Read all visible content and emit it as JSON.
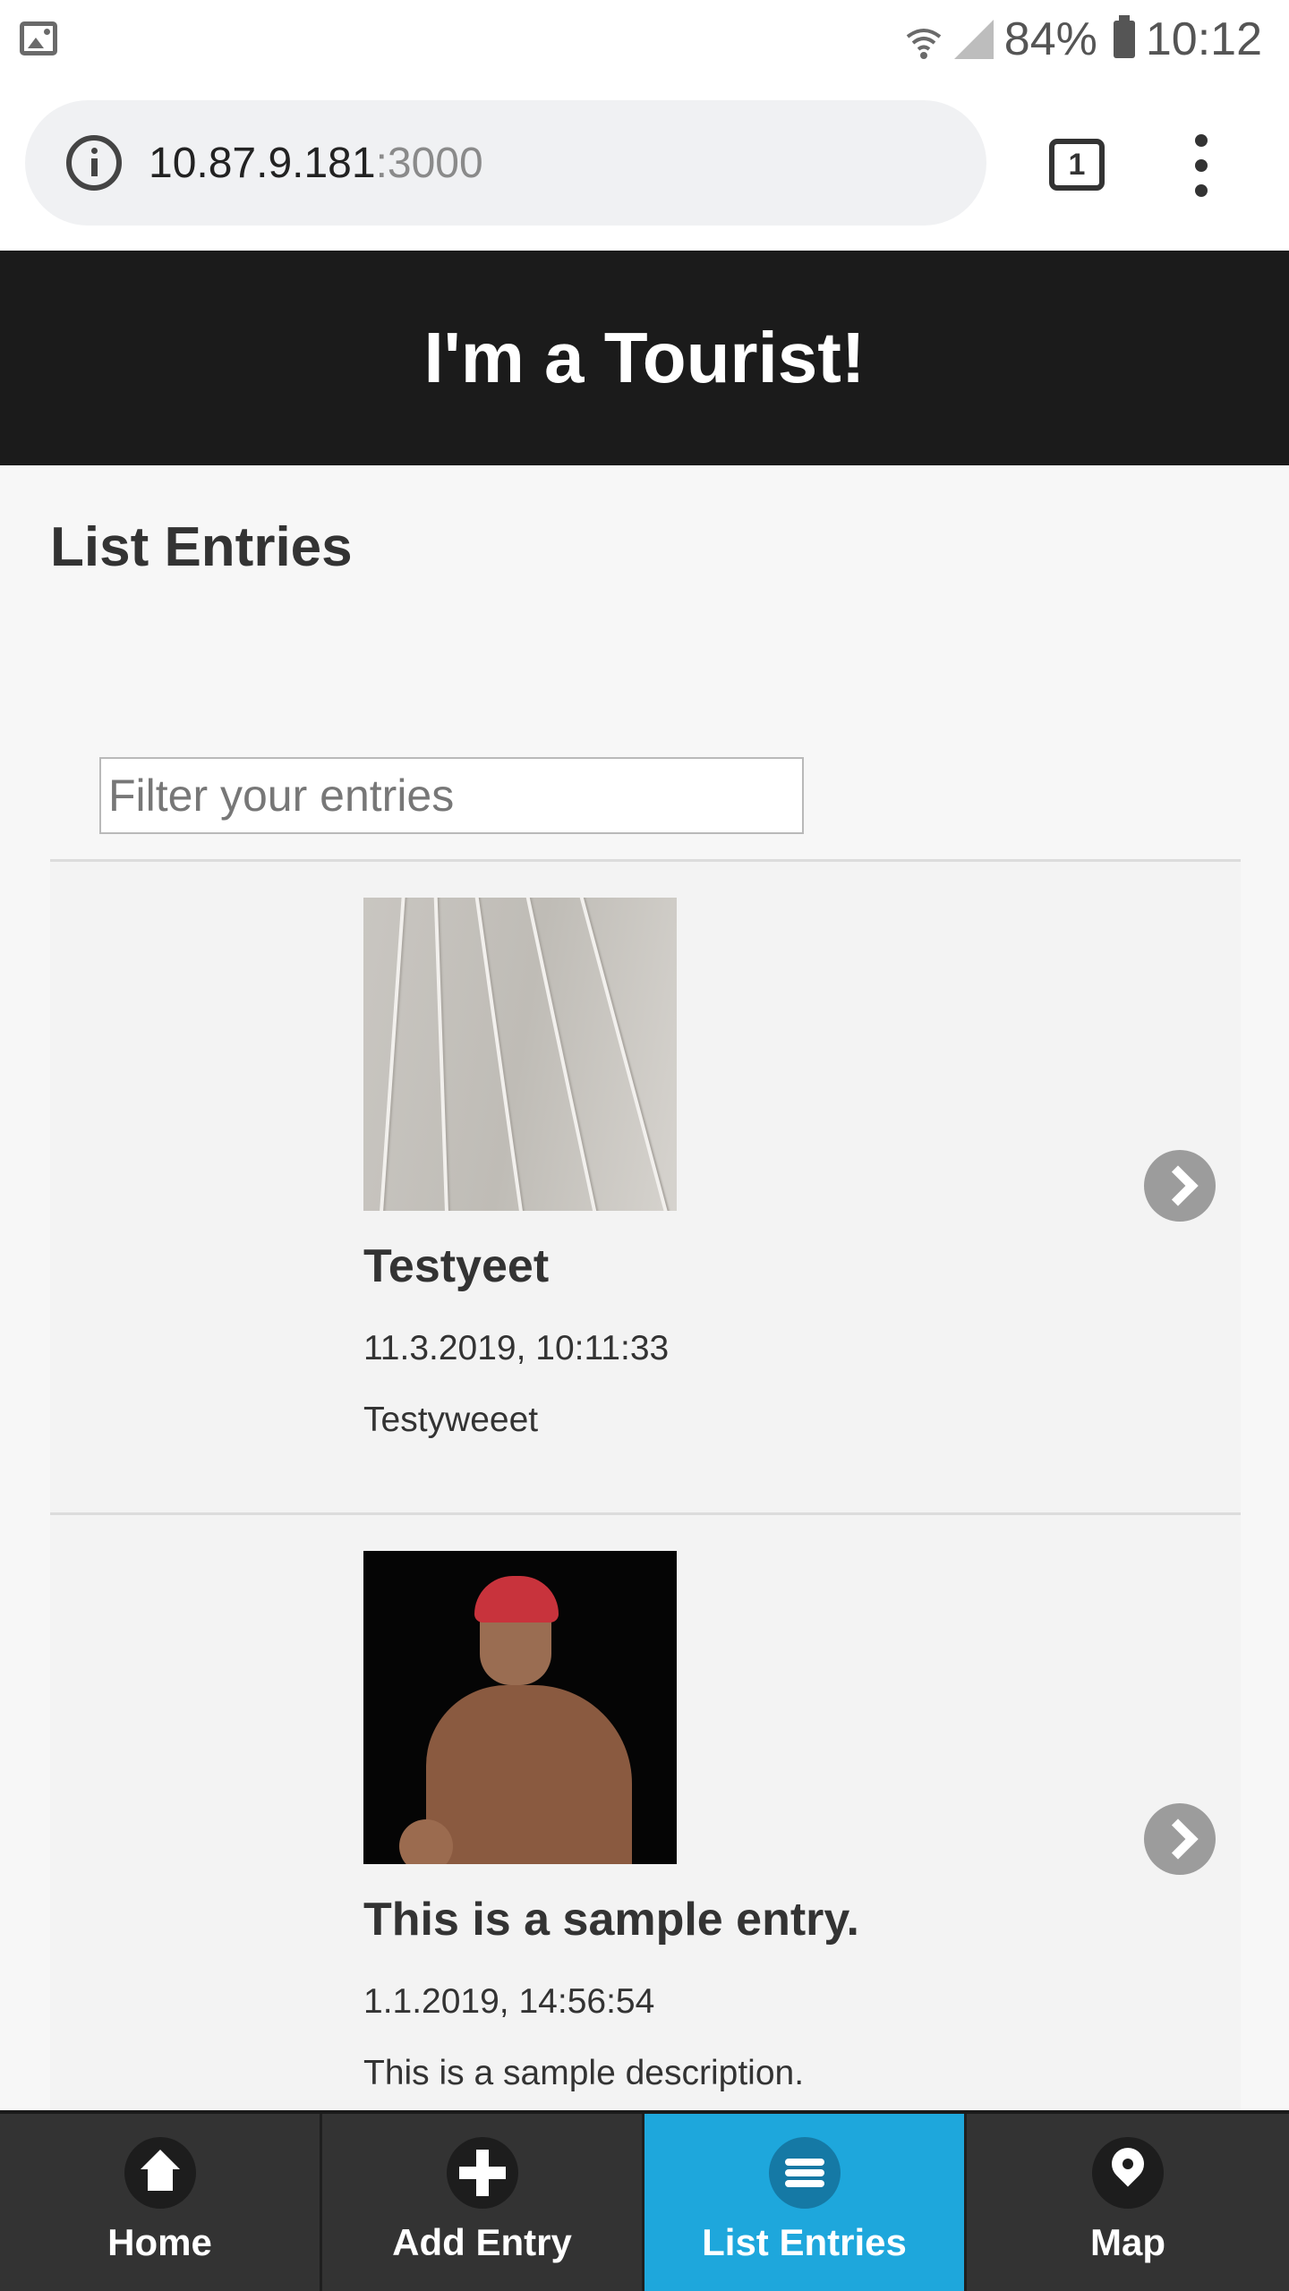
{
  "status_bar": {
    "battery": "84%",
    "time": "10:12"
  },
  "browser": {
    "url_host": "10.87.9.181",
    "url_port": ":3000",
    "tab_count": "1"
  },
  "app": {
    "title": "I'm a Tourist!"
  },
  "page": {
    "title": "List Entries",
    "filter_placeholder": "Filter your entries"
  },
  "entries": [
    {
      "title": "Testyeet",
      "date": "11.3.2019, 10:11:33",
      "description": "Testyweeet"
    },
    {
      "title": "This is a sample entry.",
      "date": "1.1.2019, 14:56:54",
      "description": "This is a sample description."
    }
  ],
  "nav": {
    "items": [
      {
        "label": "Home",
        "icon": "home-icon"
      },
      {
        "label": "Add Entry",
        "icon": "plus-icon"
      },
      {
        "label": "List Entries",
        "icon": "bars-icon"
      },
      {
        "label": "Map",
        "icon": "map-pin-icon"
      }
    ],
    "active_index": 2,
    "active_color": "#1ea7dc"
  }
}
